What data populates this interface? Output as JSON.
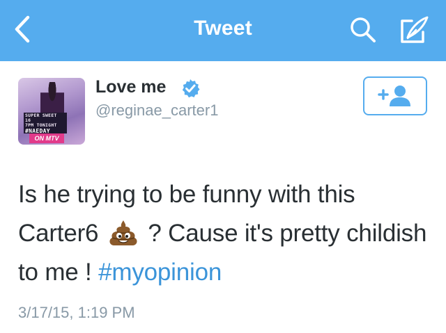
{
  "navbar": {
    "title": "Tweet",
    "back_icon": "chevron-left-icon",
    "search_icon": "search-icon",
    "compose_icon": "compose-quill-icon",
    "bg_color": "#55acee"
  },
  "user": {
    "display_name": "Love me",
    "username": "@reginae_carter1",
    "verified": true,
    "avatar_banner": [
      "SUPER SWEET 16",
      "7PM TONIGHT",
      "#NAEDAY"
    ],
    "avatar_footer": "ON MTV"
  },
  "follow_button": {
    "icon": "add-user-icon",
    "label": "+"
  },
  "tweet": {
    "text_part1": "Is he trying to be funny with this Carter6",
    "emoji": "pile-of-poo",
    "text_part2": "? Cause it's pretty childish to me !",
    "hashtag": "#myopinion",
    "timestamp": "3/17/15, 1:19 PM"
  },
  "colors": {
    "link": "#3b94d9",
    "secondary_text": "#8899a6",
    "primary_text": "#292f33"
  }
}
